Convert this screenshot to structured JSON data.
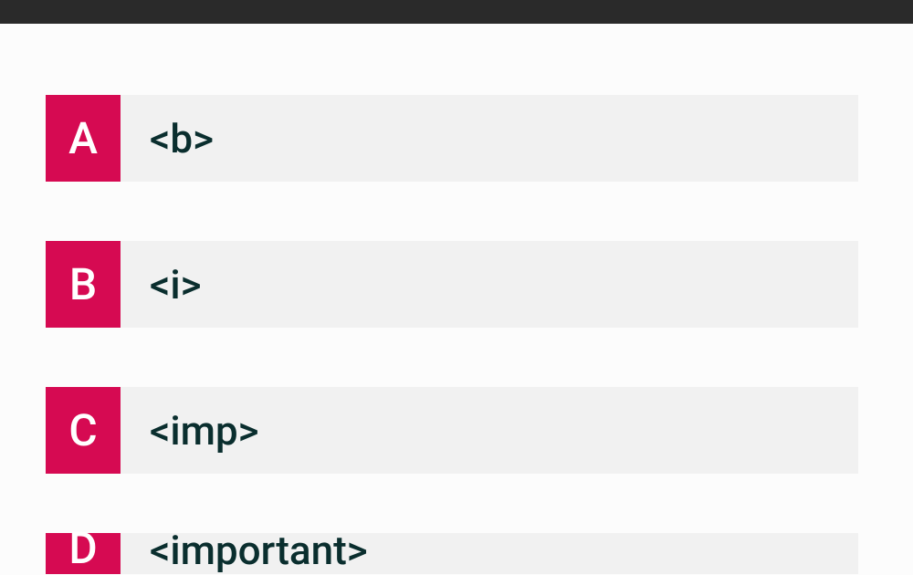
{
  "options": [
    {
      "letter": "A",
      "text": "<b>"
    },
    {
      "letter": "B",
      "text": "<i>"
    },
    {
      "letter": "C",
      "text": "<imp>"
    },
    {
      "letter": "D",
      "text": "<important>"
    }
  ]
}
